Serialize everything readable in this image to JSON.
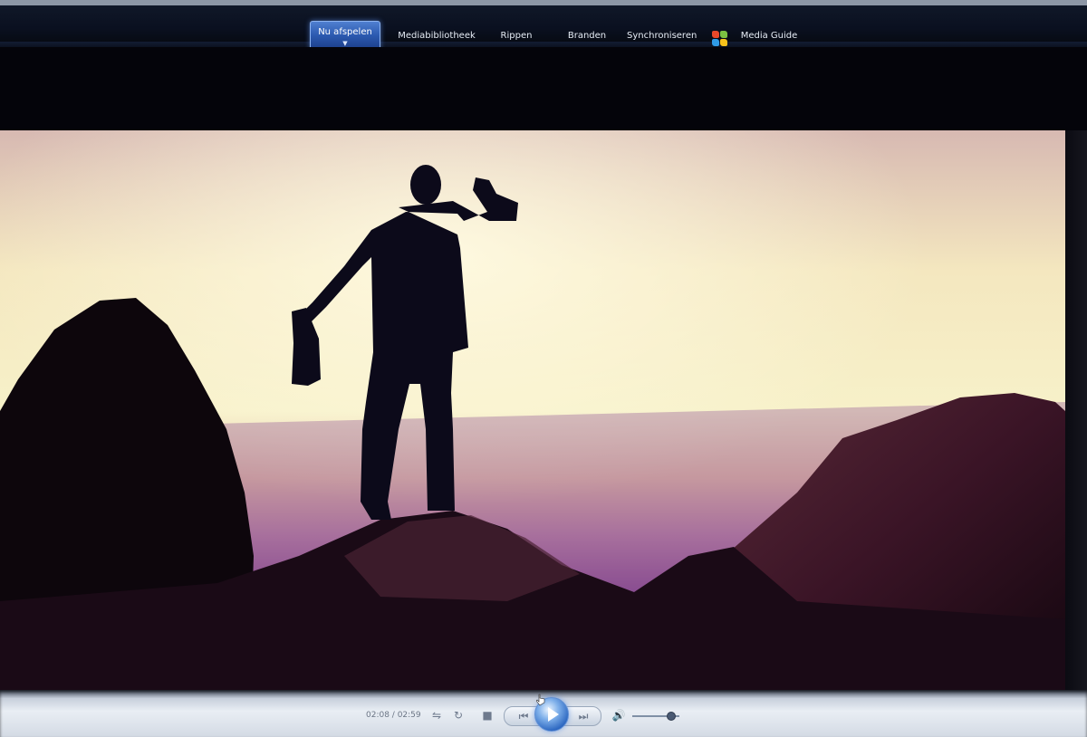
{
  "nav": {
    "items": [
      {
        "label": "Nu afspelen",
        "active": true
      },
      {
        "label": "Mediabibliotheek",
        "active": false
      },
      {
        "label": "Rippen",
        "active": false
      },
      {
        "label": "Branden",
        "active": false
      },
      {
        "label": "Synchroniseren",
        "active": false
      },
      {
        "label": "Media Guide",
        "active": false
      }
    ]
  },
  "player": {
    "elapsed_time": "02:08 / 02:59",
    "state": "paused",
    "volume": 0.8
  },
  "colors": {
    "accent": "#2c5ab0",
    "nav_background": "#0a1020",
    "control_background": "#e9eef4"
  },
  "icons": {
    "shuffle": "shuffle-icon",
    "repeat": "repeat-icon",
    "stop": "stop-icon",
    "previous": "previous-icon",
    "play": "play-icon",
    "next": "next-icon",
    "volume": "speaker-icon"
  }
}
